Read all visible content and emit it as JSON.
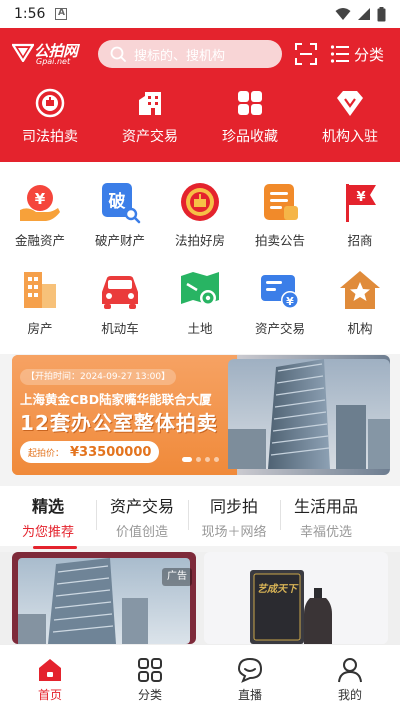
{
  "status_bar": {
    "time": "1:56",
    "notif_letter": "A"
  },
  "header": {
    "logo_text": "公拍网",
    "logo_sub": "Gpai.net",
    "search_placeholder": "搜标的、搜机构",
    "category_label": "分类"
  },
  "top_nav": [
    {
      "label": "司法拍卖",
      "icon": "court-emblem-icon"
    },
    {
      "label": "资产交易",
      "icon": "building-icon"
    },
    {
      "label": "珍品收藏",
      "icon": "grid-blocks-icon"
    },
    {
      "label": "机构入驻",
      "icon": "diamond-icon"
    }
  ],
  "grid": [
    {
      "label": "金融资产",
      "icon": "hand-yen-icon"
    },
    {
      "label": "破产财产",
      "icon": "bankrupt-search-icon"
    },
    {
      "label": "法拍好房",
      "icon": "court-emblem-icon"
    },
    {
      "label": "拍卖公告",
      "icon": "notice-icon"
    },
    {
      "label": "招商",
      "icon": "flag-yen-icon"
    },
    {
      "label": "房产",
      "icon": "buildings-icon"
    },
    {
      "label": "机动车",
      "icon": "car-icon"
    },
    {
      "label": "土地",
      "icon": "land-pin-icon"
    },
    {
      "label": "资产交易",
      "icon": "card-yen-icon"
    },
    {
      "label": "机构",
      "icon": "house-star-icon"
    }
  ],
  "grid_icon_text": {
    "bankrupt": "破"
  },
  "banner": {
    "time_text": "【开拍时间：2024-09-27 13:00】",
    "title": "上海黄金CBD陆家嘴华能联合大厦",
    "headline": "12套办公室整体拍卖",
    "price_label": "起拍价：",
    "price_value": "¥33500000"
  },
  "tabs": [
    {
      "title": "精选",
      "sub": "为您推荐",
      "active": true
    },
    {
      "title": "资产交易",
      "sub": "价值创造"
    },
    {
      "title": "同步拍",
      "sub": "现场＋网络"
    },
    {
      "title": "生活用品",
      "sub": "幸福优选"
    }
  ],
  "cards": {
    "ad_badge": "广告",
    "liquor_label": "艺成天下"
  },
  "bottom_nav": [
    {
      "label": "首页",
      "icon": "home-icon",
      "active": true
    },
    {
      "label": "分类",
      "icon": "category-icon"
    },
    {
      "label": "直播",
      "icon": "live-chat-icon"
    },
    {
      "label": "我的",
      "icon": "user-icon"
    }
  ],
  "colors": {
    "brand_red": "#e4232d",
    "banner_orange": "#f08a3a"
  }
}
